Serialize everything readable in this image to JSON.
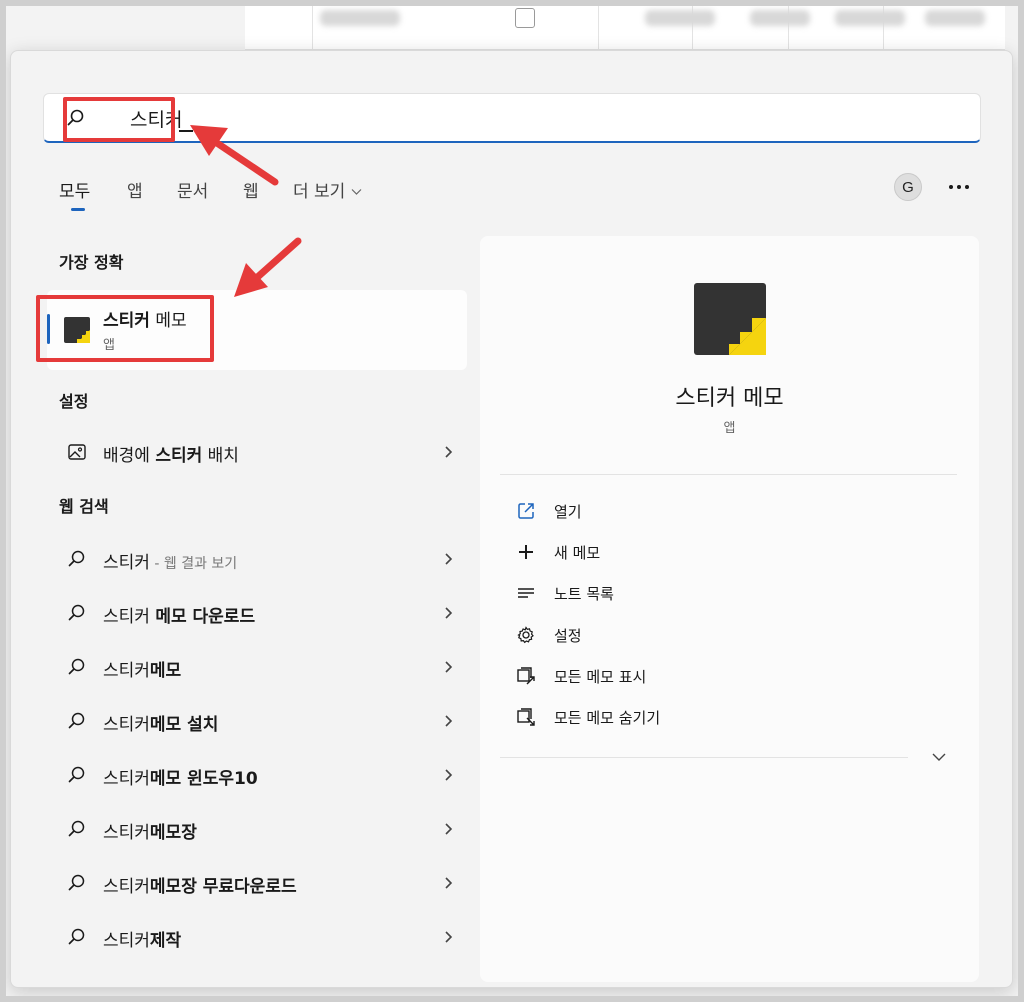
{
  "search": {
    "value": "스티커"
  },
  "tabs": [
    {
      "label": "모두",
      "active": true
    },
    {
      "label": "앱"
    },
    {
      "label": "문서"
    },
    {
      "label": "웹"
    },
    {
      "label": "더 보기"
    }
  ],
  "account": {
    "initial": "G"
  },
  "best_match": {
    "section": "가장 정확",
    "name_bold": "스티커",
    "name_rest": " 메모",
    "type": "앱"
  },
  "settings": {
    "section": "설정",
    "item": {
      "pre": "배경에 ",
      "bold": "스티커",
      "post": " 배치"
    }
  },
  "web": {
    "section": "웹 검색",
    "items": [
      {
        "plain": "스티커",
        "bold": "",
        "muted": " - 웹 결과 보기"
      },
      {
        "plain": "스티커 ",
        "bold": "메모 다운로드",
        "muted": ""
      },
      {
        "plain": "스티커",
        "bold": "메모",
        "muted": ""
      },
      {
        "plain": "스티커",
        "bold": "메모 설치",
        "muted": ""
      },
      {
        "plain": "스티커",
        "bold": "메모 윈도우10",
        "muted": ""
      },
      {
        "plain": "스티커",
        "bold": "메모장",
        "muted": ""
      },
      {
        "plain": "스티커",
        "bold": "메모장 무료다운로드",
        "muted": ""
      },
      {
        "plain": "스티커",
        "bold": "제작",
        "muted": ""
      }
    ]
  },
  "detail": {
    "title": "스티커 메모",
    "subtitle": "앱",
    "actions": [
      {
        "label": "열기",
        "icon": "open-external-icon"
      },
      {
        "label": "새 메모",
        "icon": "plus-icon"
      },
      {
        "label": "노트 목록",
        "icon": "list-icon"
      },
      {
        "label": "설정",
        "icon": "gear-icon"
      },
      {
        "label": "모든 메모 표시",
        "icon": "show-all-notes-icon"
      },
      {
        "label": "모든 메모 숨기기",
        "icon": "hide-all-notes-icon"
      }
    ]
  },
  "colors": {
    "accent": "#1d64bd",
    "annotation": "#e53a3a",
    "app_icon_dark": "#333333",
    "app_icon_yellow": "#f5d40f"
  }
}
